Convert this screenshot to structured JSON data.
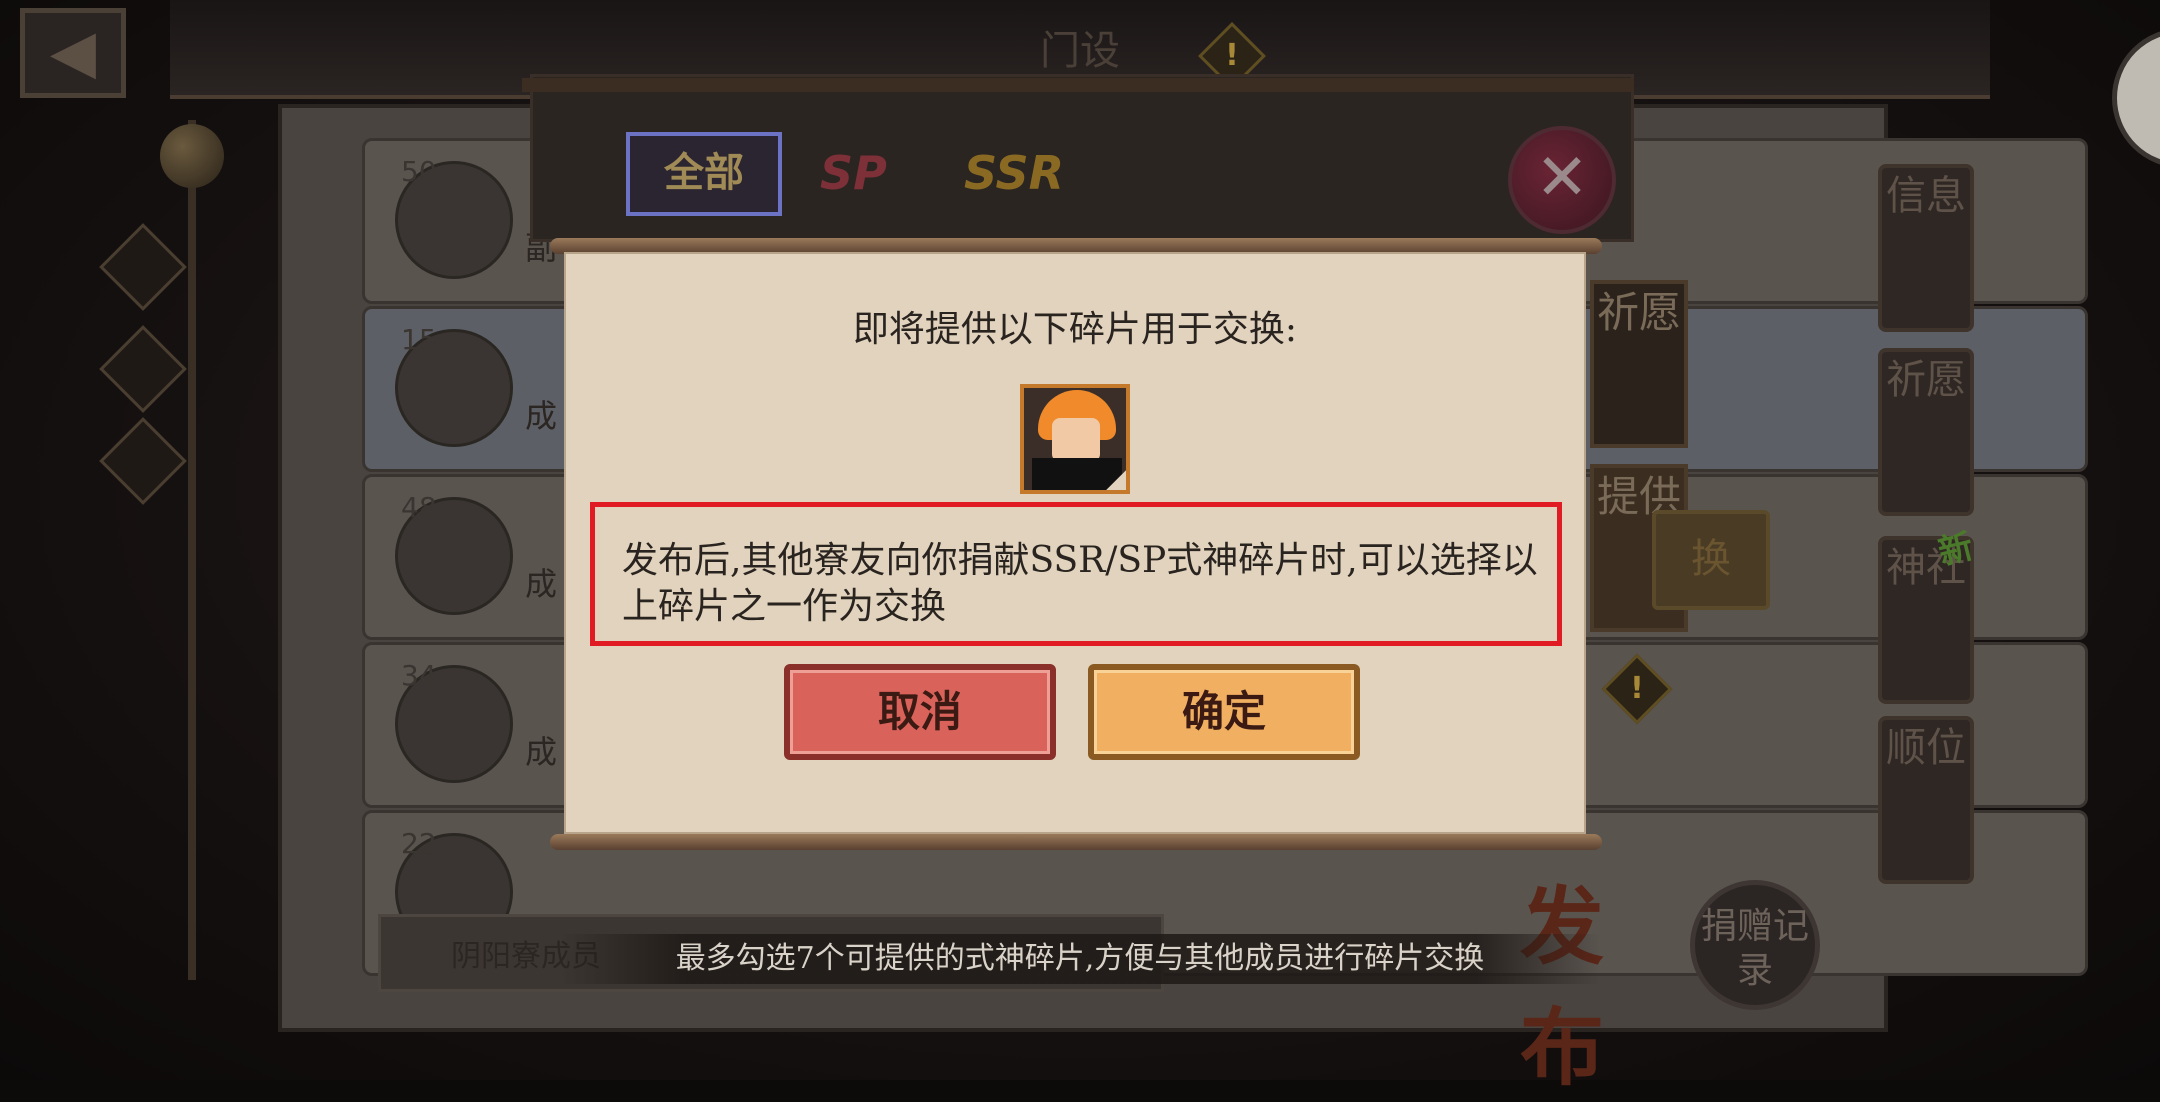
{
  "top": {
    "title": "门设"
  },
  "tabs": {
    "all": "全部",
    "sp": "SP",
    "ssr": "SSR"
  },
  "list": {
    "rows": [
      {
        "level": "50",
        "text": "副"
      },
      {
        "level": "15",
        "text": "成"
      },
      {
        "level": "48",
        "text": "成"
      },
      {
        "level": "34",
        "text": "成"
      },
      {
        "level": "22",
        "text": ""
      }
    ],
    "bottom_bar": "阴阳寮成员"
  },
  "side_tabs": [
    "信息",
    "祈愿",
    "神社",
    "顺位"
  ],
  "side_new_badge": "新",
  "behind": {
    "wish_tab": "祈愿",
    "provide_tab": "提供",
    "exchange_button": "换"
  },
  "dialog": {
    "heading": "即将提供以下碎片用于交换:",
    "body": "发布后,其他寮友向你捐献SSR/SP式神碎片时,可以选择以上碎片之一作为交换",
    "cancel_label": "取消",
    "confirm_label": "确定"
  },
  "bottom_hint": "最多勾选7个可提供的式神碎片,方便与其他成员进行碎片交换",
  "publish_label": "发布",
  "donation_record_label": "捐赠记录",
  "colors": {
    "dialog_bg": "#e1d3bd",
    "highlight": "#e11b23",
    "cancel": "#d9625a",
    "confirm": "#f1b061"
  }
}
